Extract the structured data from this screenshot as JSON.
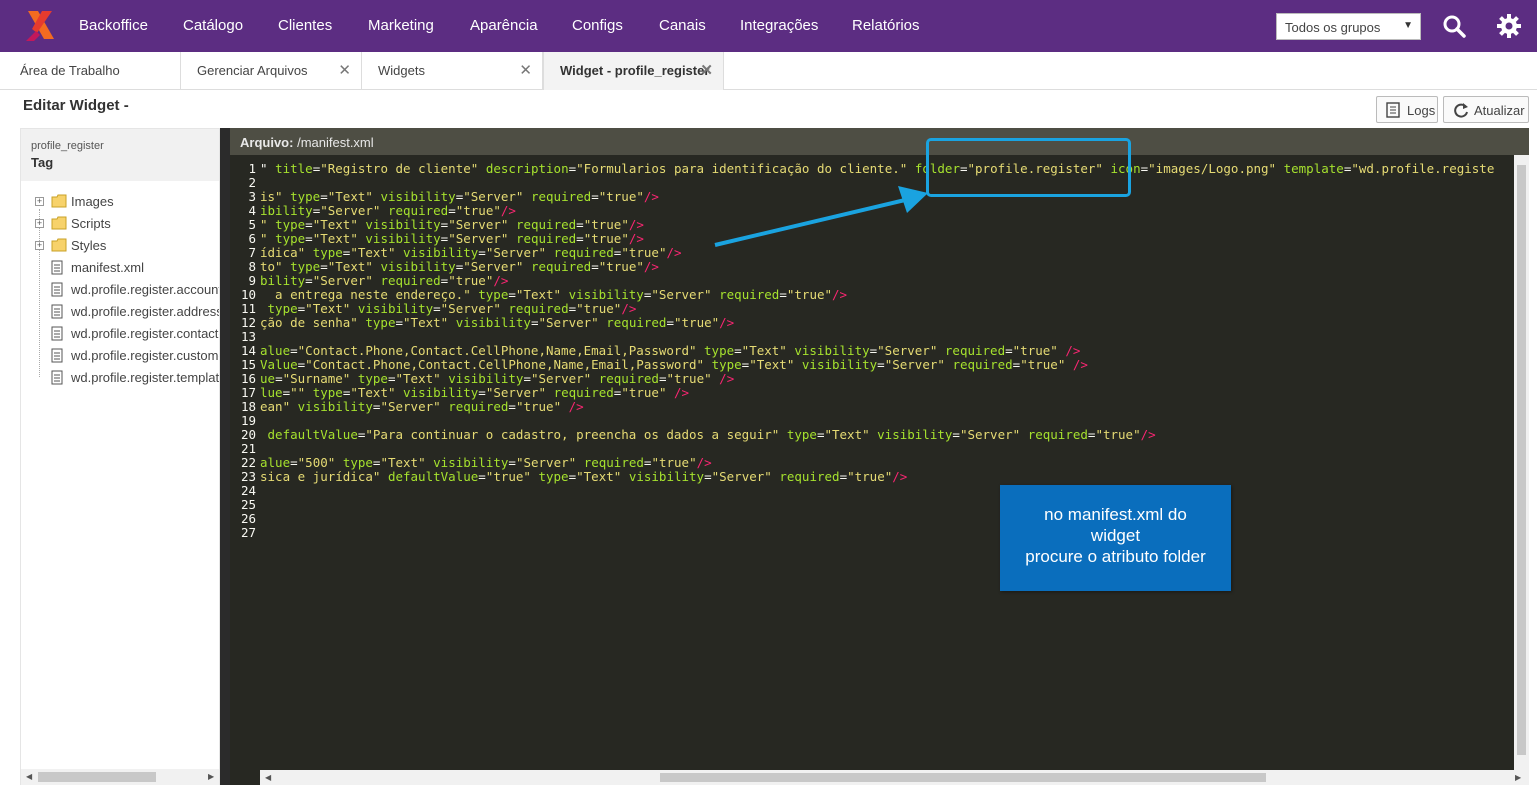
{
  "nav": {
    "items": [
      {
        "label": "Backoffice"
      },
      {
        "label": "Catálogo"
      },
      {
        "label": "Clientes"
      },
      {
        "label": "Marketing"
      },
      {
        "label": "Aparência"
      },
      {
        "label": "Configs"
      },
      {
        "label": "Canais"
      },
      {
        "label": "Integrações"
      },
      {
        "label": "Relatórios"
      }
    ],
    "group_select": "Todos os grupos",
    "brand_color": "#5c2d82"
  },
  "tabs": [
    {
      "label": "Área de Trabalho"
    },
    {
      "label": "Gerenciar Arquivos"
    },
    {
      "label": "Widgets"
    },
    {
      "label": "Widget - profile_register"
    }
  ],
  "page": {
    "title": "Editar Widget -",
    "logs_label": "Logs",
    "refresh_label": "Atualizar"
  },
  "sidebar": {
    "subtitle": "profile_register",
    "tag": "Tag",
    "items": [
      {
        "label": "Images",
        "type": "folder"
      },
      {
        "label": "Scripts",
        "type": "folder"
      },
      {
        "label": "Styles",
        "type": "folder"
      },
      {
        "label": "manifest.xml",
        "type": "file"
      },
      {
        "label": "wd.profile.register.accountdata",
        "type": "file"
      },
      {
        "label": "wd.profile.register.addressdata",
        "type": "file"
      },
      {
        "label": "wd.profile.register.contactdata",
        "type": "file"
      },
      {
        "label": "wd.profile.register.customerdata",
        "type": "file"
      },
      {
        "label": "wd.profile.register.template",
        "type": "file"
      }
    ]
  },
  "editor": {
    "file_label": "Arquivo:",
    "file_path": "/manifest.xml",
    "line_numbers": [
      "1",
      "2",
      "3",
      "4",
      "5",
      "6",
      "7",
      "8",
      "9",
      "10",
      "11",
      "12",
      "13",
      "14",
      "15",
      "16",
      "17",
      "18",
      "19",
      "20",
      "21",
      "22",
      "23",
      "24",
      "25",
      "26",
      "27"
    ]
  },
  "annotation": {
    "line1": "no manifest.xml do",
    "line2": "widget",
    "line3": "procure o atributo folder"
  },
  "colors": {
    "editor_bg": "#272822",
    "attr": "#a6e22e",
    "string": "#e6db74",
    "tag": "#f92672",
    "highlight": "#1aa3e0",
    "callout": "#0a6ebd"
  }
}
